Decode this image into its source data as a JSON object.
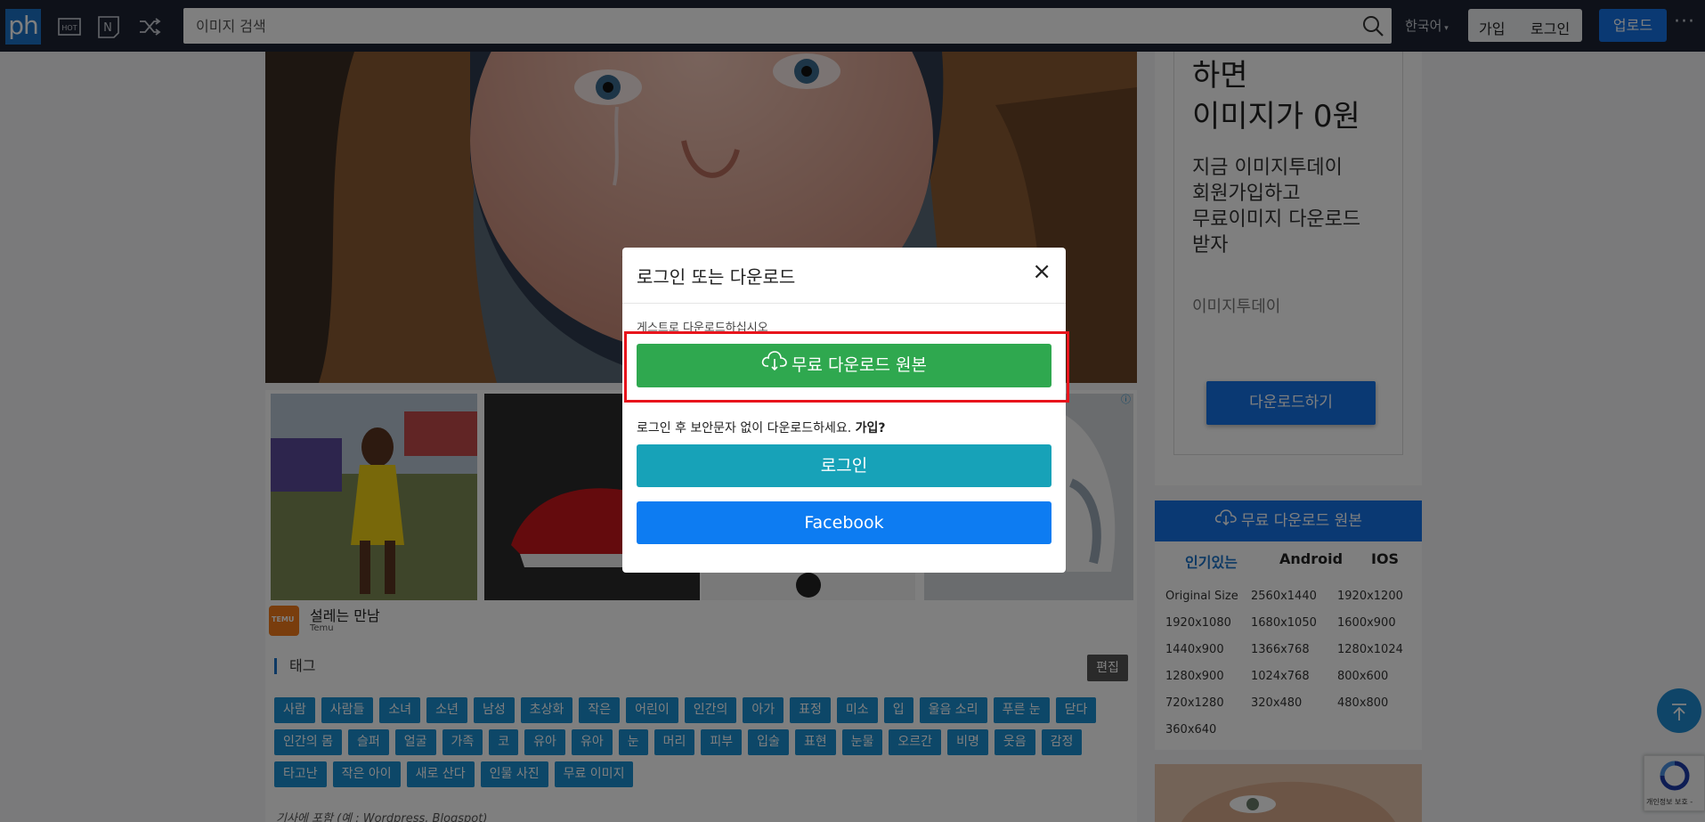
{
  "header": {
    "logo": "ph",
    "search_placeholder": "이미지 검색",
    "language": "한국어",
    "signup": "가입",
    "login": "로그인",
    "upload": "업로드",
    "more": "···"
  },
  "ad": {
    "brand_caption": "설레는 만남",
    "brand_name": "Temu"
  },
  "tags_section": {
    "title": "태그",
    "edit": "편집",
    "tags": [
      "사람",
      "사람들",
      "소녀",
      "소년",
      "남성",
      "초상화",
      "작은",
      "어린이",
      "인간의",
      "아가",
      "표정",
      "미소",
      "입",
      "울음 소리",
      "푸른 눈",
      "닫다",
      "인간의 몸",
      "슬퍼",
      "얼굴",
      "가족",
      "코",
      "유아",
      "유아",
      "눈",
      "머리",
      "피부",
      "입술",
      "표현",
      "눈물",
      "오르간",
      "비명",
      "웃음",
      "감정",
      "타고난",
      "작은 아이",
      "새로 산다",
      "인물 사진",
      "무료 이미지"
    ],
    "article_line": "기사에 포함 (예 : Wordpress, Blogspot)"
  },
  "sidebar": {
    "big_text": [
      "하면",
      "이미지가 0원"
    ],
    "mid_text": [
      "지금 이미지투데이",
      "회원가입하고",
      "무료이미지 다운로드",
      "받자"
    ],
    "brand": "이미지투데이",
    "download": "다운로드하기"
  },
  "resolutions": {
    "download_label": "무료 다운로드 원본",
    "tabs": [
      "인기있는",
      "Android",
      "IOS"
    ],
    "items": [
      "Original Size",
      "2560x1440",
      "1920x1200",
      "1920x1080",
      "1680x1050",
      "1600x900",
      "1440x900",
      "1366x768",
      "1280x1024",
      "1280x900",
      "1024x768",
      "800x600",
      "720x1280",
      "320x480",
      "480x800",
      "360x640"
    ]
  },
  "recaptcha": {
    "text": "개인정보 보호 -"
  },
  "modal": {
    "title": "로그인 또는 다운로드",
    "close": "×",
    "guest_text": "게스트로 다운로드하십시오",
    "free_download": "무료 다운로드 원본",
    "login_hint": "로그인 후 보안문자 없이 다운로드하세요.",
    "signup_link": "가입?",
    "login_button": "로그인",
    "facebook_button": "Facebook"
  },
  "colors": {
    "header_bg": "#1c2333",
    "accent_blue": "#1473e6",
    "green": "#2fa84f",
    "teal": "#17a2b8",
    "facebook_blue": "#0d7cf2",
    "highlight_red": "#e8141c",
    "tag_blue": "#1b8fd0"
  }
}
